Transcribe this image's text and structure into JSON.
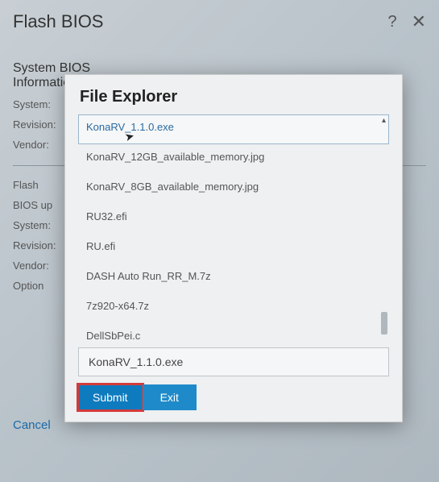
{
  "window": {
    "title": "Flash BIOS",
    "help": "?",
    "close": "✕"
  },
  "background": {
    "section1_line1": "System BIOS",
    "section1_line2": "Information",
    "labels": {
      "system": "System:",
      "revision": "Revision:",
      "vendor": "Vendor:",
      "flash": "Flash",
      "bios_up": "BIOS up",
      "option": "Option"
    },
    "cancel": "Cancel"
  },
  "modal": {
    "title": "File Explorer",
    "files": [
      "KonaRV_1.1.0.exe",
      "KonaRV_12GB_available_memory.jpg",
      "KonaRV_8GB_available_memory.jpg",
      "RU32.efi",
      "RU.efi",
      "DASH Auto Run_RR_M.7z",
      "7z920-x64.7z",
      "DellSbPei.c"
    ],
    "selected_index": 0,
    "selected_file": "KonaRV_1.1.0.exe",
    "buttons": {
      "submit": "Submit",
      "exit": "Exit"
    }
  }
}
